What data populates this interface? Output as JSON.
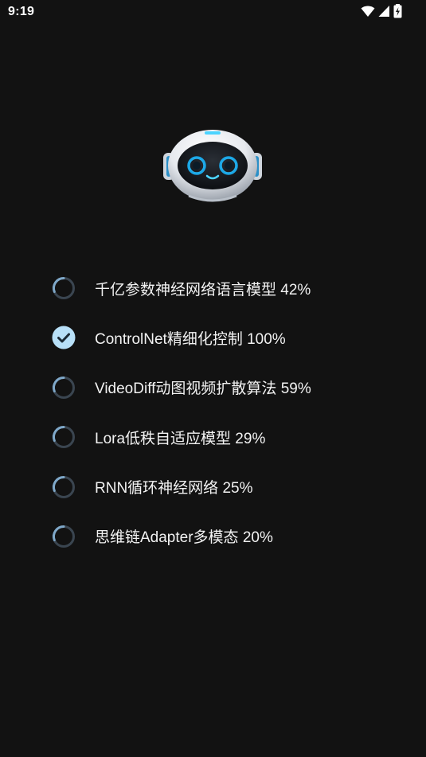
{
  "status_bar": {
    "time": "9:19",
    "icons": [
      "wifi-icon",
      "cellular-signal-icon",
      "battery-charging-icon"
    ]
  },
  "header": {
    "image": "robot-mascot"
  },
  "tasks": [
    {
      "label": "千亿参数神经网络语言模型 42%",
      "progress": 0.42,
      "state": "loading"
    },
    {
      "label": "ControlNet精细化控制 100%",
      "progress": 1.0,
      "state": "done"
    },
    {
      "label": "VideoDiff动图视频扩散算法 59%",
      "progress": 0.59,
      "state": "loading"
    },
    {
      "label": "Lora低秩自适应模型 29%",
      "progress": 0.29,
      "state": "loading"
    },
    {
      "label": "RNN循环神经网络 25%",
      "progress": 0.25,
      "state": "loading"
    },
    {
      "label": "思维链Adapter多模态 20%",
      "progress": 0.2,
      "state": "loading"
    }
  ],
  "colors": {
    "background": "#121212",
    "spinner_active": "#7fa8c9",
    "spinner_track": "#3a4550",
    "check_fill": "#b8e0f8",
    "check_mark": "#1b2a36"
  }
}
